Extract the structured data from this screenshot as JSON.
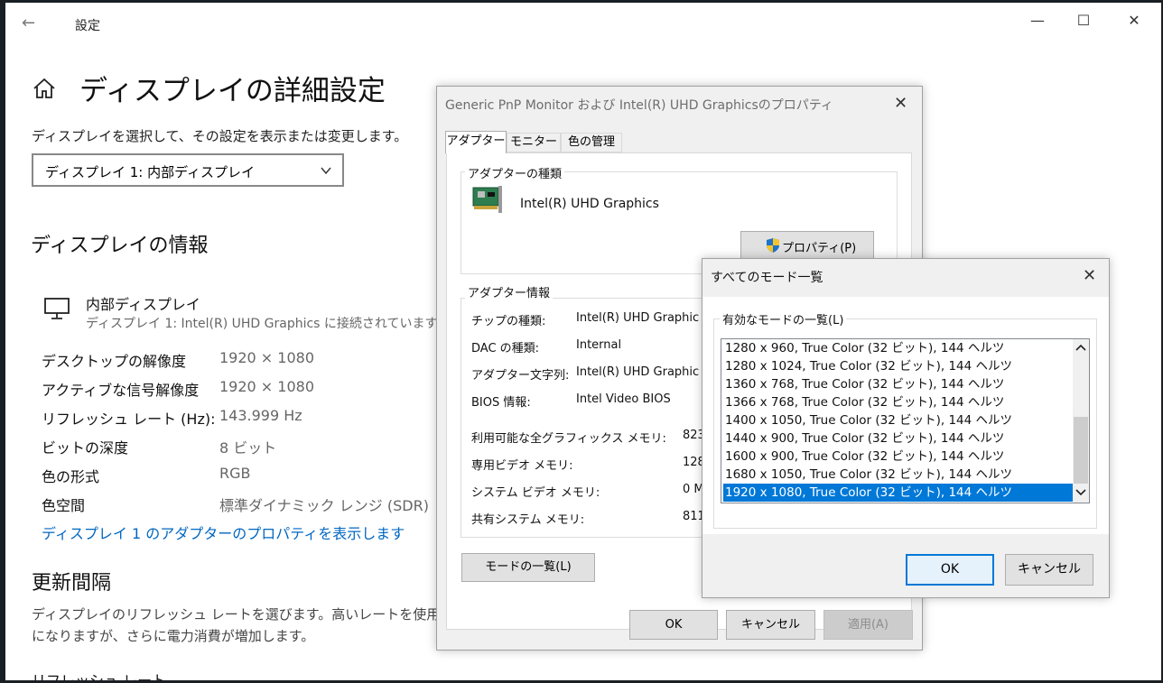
{
  "settings": {
    "window_title": "設定",
    "back_glyph": "←",
    "min_glyph": "—",
    "max_glyph": "☐",
    "close_glyph": "✕",
    "page_title": "ディスプレイの詳細設定",
    "select_instruction": "ディスプレイを選択して、その設定を表示または変更します。",
    "display_select_value": "ディスプレイ 1: 内部ディスプレイ",
    "info_heading": "ディスプレイの情報",
    "display_name": "内部ディスプレイ",
    "display_connection": "ディスプレイ 1: Intel(R) UHD Graphics に接続されています",
    "info_rows": [
      {
        "label": "デスクトップの解像度",
        "value": "1920 × 1080"
      },
      {
        "label": "アクティブな信号解像度",
        "value": "1920 × 1080"
      },
      {
        "label": "リフレッシュ レート (Hz):",
        "value": "143.999 Hz"
      },
      {
        "label": "ビットの深度",
        "value": "8 ビット"
      },
      {
        "label": "色の形式",
        "value": "RGB"
      },
      {
        "label": "色空間",
        "value": "標準ダイナミック レンジ (SDR)"
      }
    ],
    "adapter_link": "ディスプレイ 1 のアダプターのプロパティを表示します",
    "refresh_heading": "更新間隔",
    "refresh_desc_line1": "ディスプレイのリフレッシュ レートを選びます。高いレートを使用すると、",
    "refresh_desc_line2": "になりますが、さらに電力消費が増加します。",
    "refresh_rate_label_cut": "リフレッシュ レート"
  },
  "properties_dialog": {
    "title": "Generic PnP Monitor および Intel(R) UHD Graphicsのプロパティ",
    "close_glyph": "✕",
    "tabs": [
      "アダプター",
      "モニター",
      "色の管理"
    ],
    "adapter_type_group": "アダプターの種類",
    "adapter_name": "Intel(R) UHD Graphics",
    "properties_button": "プロパティ(P)",
    "adapter_info_group": "アダプター情報",
    "info_rows": [
      {
        "label": "チップの種類:",
        "value": "Intel(R) UHD Graphic"
      },
      {
        "label": "DAC の種類:",
        "value": "Internal"
      },
      {
        "label": "アダプター文字列:",
        "value": "Intel(R) UHD Graphic"
      },
      {
        "label": "BIOS 情報:",
        "value": "Intel Video BIOS"
      }
    ],
    "memory_rows": [
      {
        "label": "利用可能な全グラフィックス メモリ:",
        "value": "823"
      },
      {
        "label": "専用ビデオ メモリ:",
        "value": "128"
      },
      {
        "label": "システム ビデオ メモリ:",
        "value": "0 M"
      },
      {
        "label": "共有システム メモリ:",
        "value": "811"
      }
    ],
    "list_modes_button": "モードの一覧(L)",
    "ok_button": "OK",
    "cancel_button": "キャンセル",
    "apply_button": "適用(A)"
  },
  "modes_dialog": {
    "title": "すべてのモード一覧",
    "close_glyph": "✕",
    "group_label": "有効なモードの一覧(L)",
    "modes": [
      "1280 x 960, True Color (32 ビット), 144 ヘルツ",
      "1280 x 1024, True Color (32 ビット), 144 ヘルツ",
      "1360 x 768, True Color (32 ビット), 144 ヘルツ",
      "1366 x 768, True Color (32 ビット), 144 ヘルツ",
      "1400 x 1050, True Color (32 ビット), 144 ヘルツ",
      "1440 x 900, True Color (32 ビット), 144 ヘルツ",
      "1600 x 900, True Color (32 ビット), 144 ヘルツ",
      "1680 x 1050, True Color (32 ビット), 144 ヘルツ",
      "1920 x 1080, True Color (32 ビット), 144 ヘルツ"
    ],
    "selected_mode": "1920 x 1080, True Color (32 ビット), 144 ヘルツ",
    "ok_button": "OK",
    "cancel_button": "キャンセル"
  },
  "colors": {
    "link": "#0067c0",
    "selection": "#0078d7"
  }
}
